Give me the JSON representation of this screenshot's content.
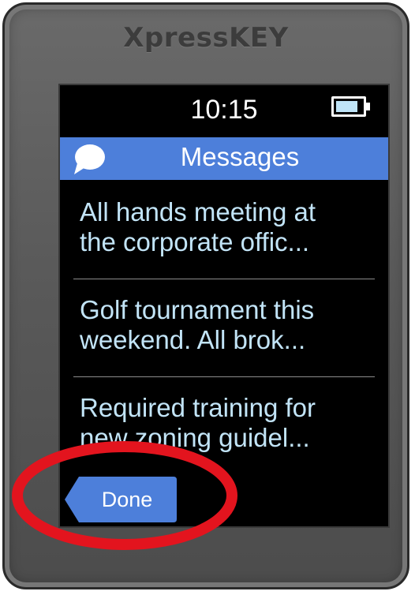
{
  "device": {
    "brand": "XpressKEY"
  },
  "status_bar": {
    "time": "10:15",
    "battery_level": 0.85,
    "battery_icon": "battery-icon"
  },
  "header": {
    "icon": "speech-bubble-icon",
    "title": "Messages",
    "color": "#4d7fda"
  },
  "messages": [
    {
      "preview": "All hands meeting at\nthe corporate offic..."
    },
    {
      "preview": "Golf tournament this\nweekend. All brok..."
    },
    {
      "preview": "Required training for\nnew zoning guidel..."
    }
  ],
  "done_button": {
    "label": "Done",
    "color": "#4d7fda"
  },
  "annotation": {
    "ring_color": "#e3141e"
  }
}
